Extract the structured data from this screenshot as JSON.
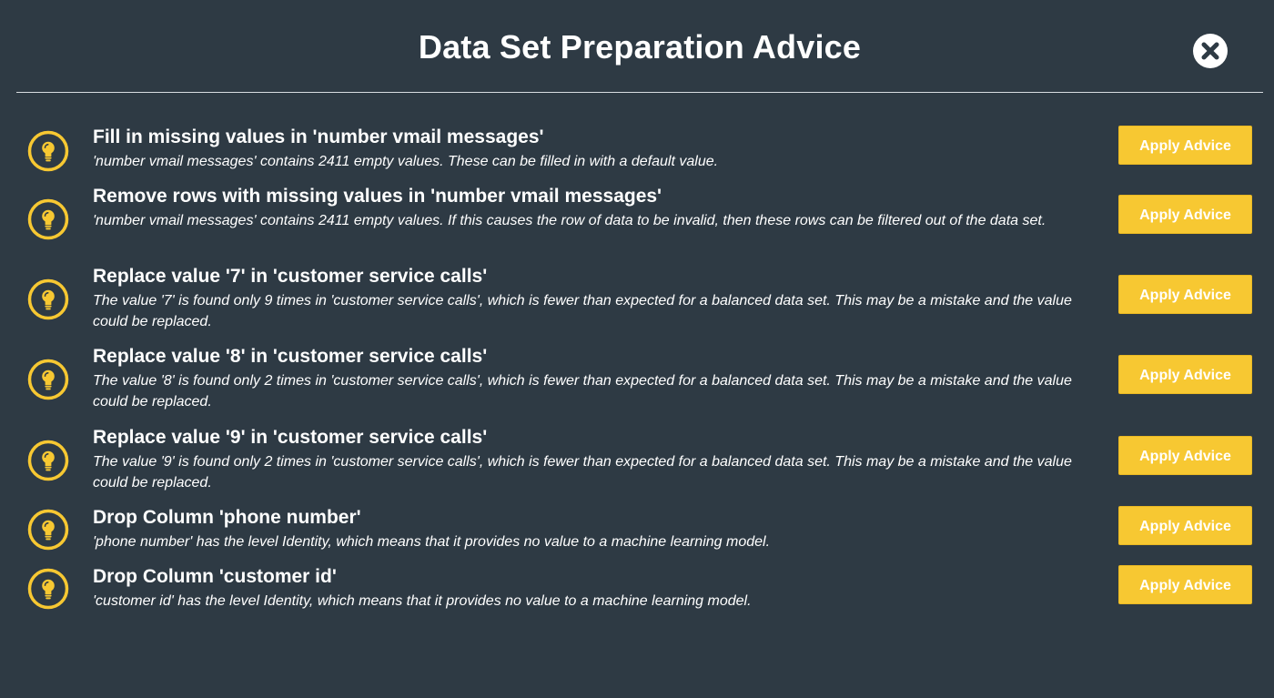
{
  "dialog": {
    "title": "Data Set Preparation Advice",
    "close_icon": "close-circle-icon"
  },
  "colors": {
    "background": "#2e3a44",
    "accent": "#f7c832",
    "text": "#ffffff"
  },
  "advice": [
    {
      "icon": "lightbulb-icon",
      "title": "Fill in missing values in 'number vmail messages'",
      "description": "'number vmail messages' contains 2411 empty values. These can be filled in with a default value.",
      "button_label": "Apply Advice"
    },
    {
      "icon": "lightbulb-icon",
      "title": "Remove rows with missing values in 'number vmail messages'",
      "description": "'number vmail messages' contains 2411 empty values. If this causes the row of data to be invalid, then these rows can be filtered out of the data set.",
      "button_label": "Apply Advice"
    },
    {
      "icon": "lightbulb-icon",
      "title": "Replace value '7' in 'customer service calls'",
      "description": "The value '7' is found only 9 times in 'customer service calls', which is fewer than expected for a balanced data set. This may be a mistake and the value could be replaced.",
      "button_label": "Apply Advice"
    },
    {
      "icon": "lightbulb-icon",
      "title": "Replace value '8' in 'customer service calls'",
      "description": "The value '8' is found only 2 times in 'customer service calls', which is fewer than expected for a balanced data set. This may be a mistake and the value could be replaced.",
      "button_label": "Apply Advice"
    },
    {
      "icon": "lightbulb-icon",
      "title": "Replace value '9' in 'customer service calls'",
      "description": "The value '9' is found only 2 times in 'customer service calls', which is fewer than expected for a balanced data set. This may be a mistake and the value could be replaced.",
      "button_label": "Apply Advice"
    },
    {
      "icon": "lightbulb-icon",
      "title": "Drop Column 'phone number'",
      "description": "'phone number' has the level Identity, which means that it provides no value to a machine learning model.",
      "button_label": "Apply Advice"
    },
    {
      "icon": "lightbulb-icon",
      "title": "Drop Column 'customer id'",
      "description": "'customer id' has the level Identity, which means that it provides no value to a machine learning model.",
      "button_label": "Apply Advice"
    }
  ]
}
